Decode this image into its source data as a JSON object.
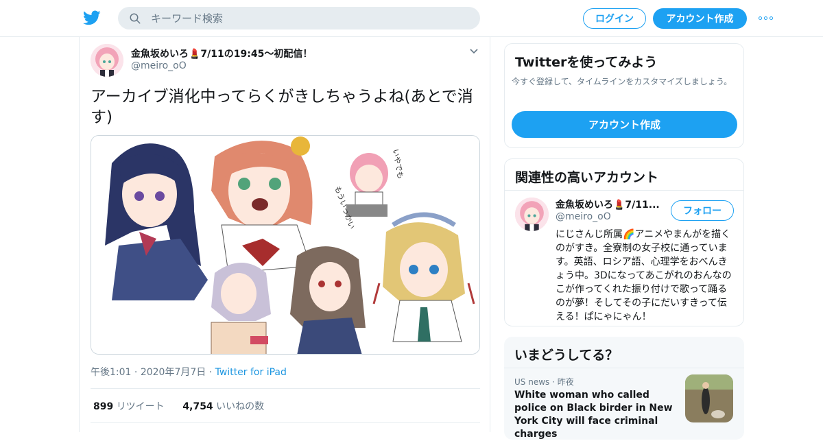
{
  "header": {
    "search_placeholder": "キーワード検索",
    "login_label": "ログイン",
    "signup_label": "アカウント作成"
  },
  "tweet": {
    "display_name": "金魚坂めいろ💄7/11の19:45〜初配信！",
    "handle": "@meiro_oO",
    "text": "アーカイブ消化中ってらくがきしちゃうよね(あとで消す)",
    "time": "午後1:01",
    "date": "2020年7月7日",
    "source": "Twitter for iPad",
    "retweets": "899",
    "retweets_label": "リツイート",
    "likes": "4,754",
    "likes_label": "いいねの数"
  },
  "try_card": {
    "title": "Twitterを使ってみよう",
    "body": "今すぐ登録して、タイムラインをカスタマイズしましょう。",
    "button": "アカウント作成"
  },
  "related_card": {
    "title": "関連性の高いアカウント",
    "name": "金魚坂めいろ💄7/11...",
    "handle": "@meiro_oO",
    "follow_label": "フォロー",
    "bio": "にじさんじ所属🌈アニメやまんがを描くのがすき。全寮制の女子校に通っています。英語、ロシア語、心理学をおべんきょう中。3Dになってあこがれのおんなのこが作ってくれた振り付けで歌って踊るのが夢！そしてその子にだいすきって伝える！ぱにゃにゃん！"
  },
  "trends_card": {
    "title": "いまどうしてる？",
    "news_source": "US news",
    "news_time": "昨夜",
    "news_title": "White woman who called police on Black birder in New York City will face criminal charges"
  },
  "colors": {
    "accent": "#1da1f2",
    "border": "#e6ecf0",
    "muted": "#657786"
  }
}
